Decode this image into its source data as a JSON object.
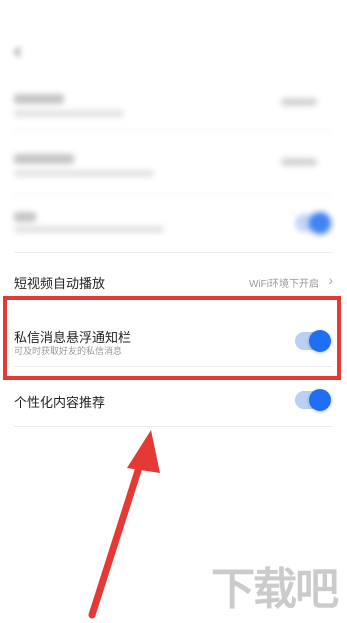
{
  "status_bar": {
    "left": "",
    "right": ""
  },
  "nav": {
    "title": ""
  },
  "rows": {
    "autoplay": {
      "title": "短视频自动播放",
      "value": "WiFi环境下开启"
    },
    "dm_float": {
      "title": "私信消息悬浮通知栏",
      "subtitle": "可及时获取好友的私信消息",
      "enabled": true
    },
    "personal": {
      "title": "个性化内容推荐",
      "enabled": true
    }
  },
  "colors": {
    "accent": "#1f6ff2",
    "highlight": "#e53935",
    "arrow": "#e53935"
  },
  "watermark": "下载吧"
}
